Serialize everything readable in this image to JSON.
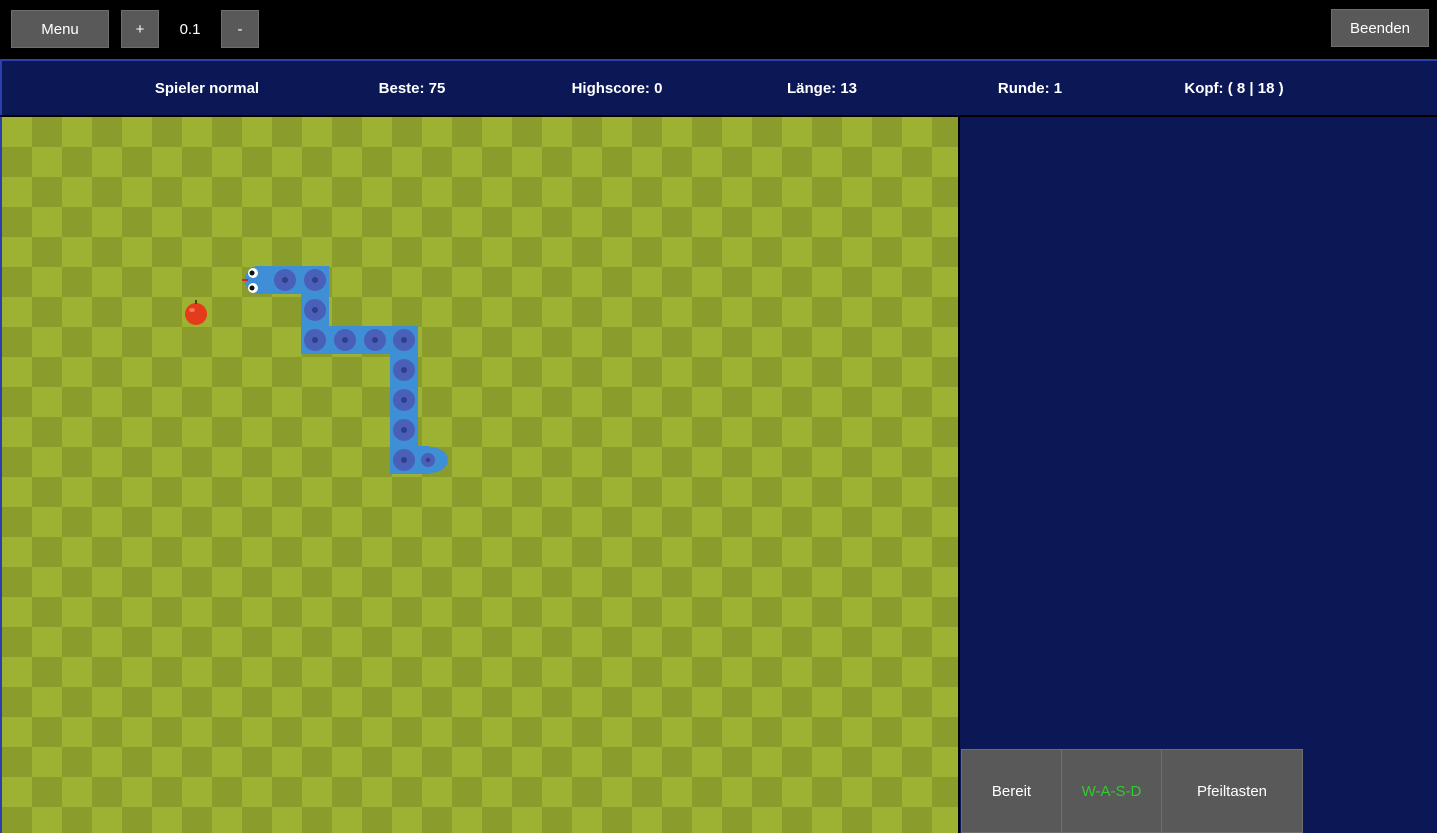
{
  "toolbar": {
    "menu_label": "Menu",
    "plus_label": "+",
    "speed_value": "0.1",
    "minus_label": "-",
    "quit_label": "Beenden"
  },
  "stats": {
    "player": "Spieler normal",
    "best": "Beste: 75",
    "highscore": "Highscore: 0",
    "length": "Länge: 13",
    "round": "Runde: 1",
    "head": "Kopf: ( 8 | 18 )"
  },
  "controls": {
    "ready_label": "Bereit",
    "wasd_label": "W-A-S-D",
    "arrows_label": "Pfeiltasten"
  },
  "colors": {
    "panel": "#0b1855",
    "board_light": "#9db232",
    "board_dark": "#8a9c2c",
    "snake_body": "#3f8fd6",
    "snake_segment": "#4a5fb8",
    "apple": "#e53b1b",
    "wasd_text": "#2ecc2e"
  },
  "icons": {
    "snake": "snake-sprite",
    "food": "apple-icon"
  }
}
